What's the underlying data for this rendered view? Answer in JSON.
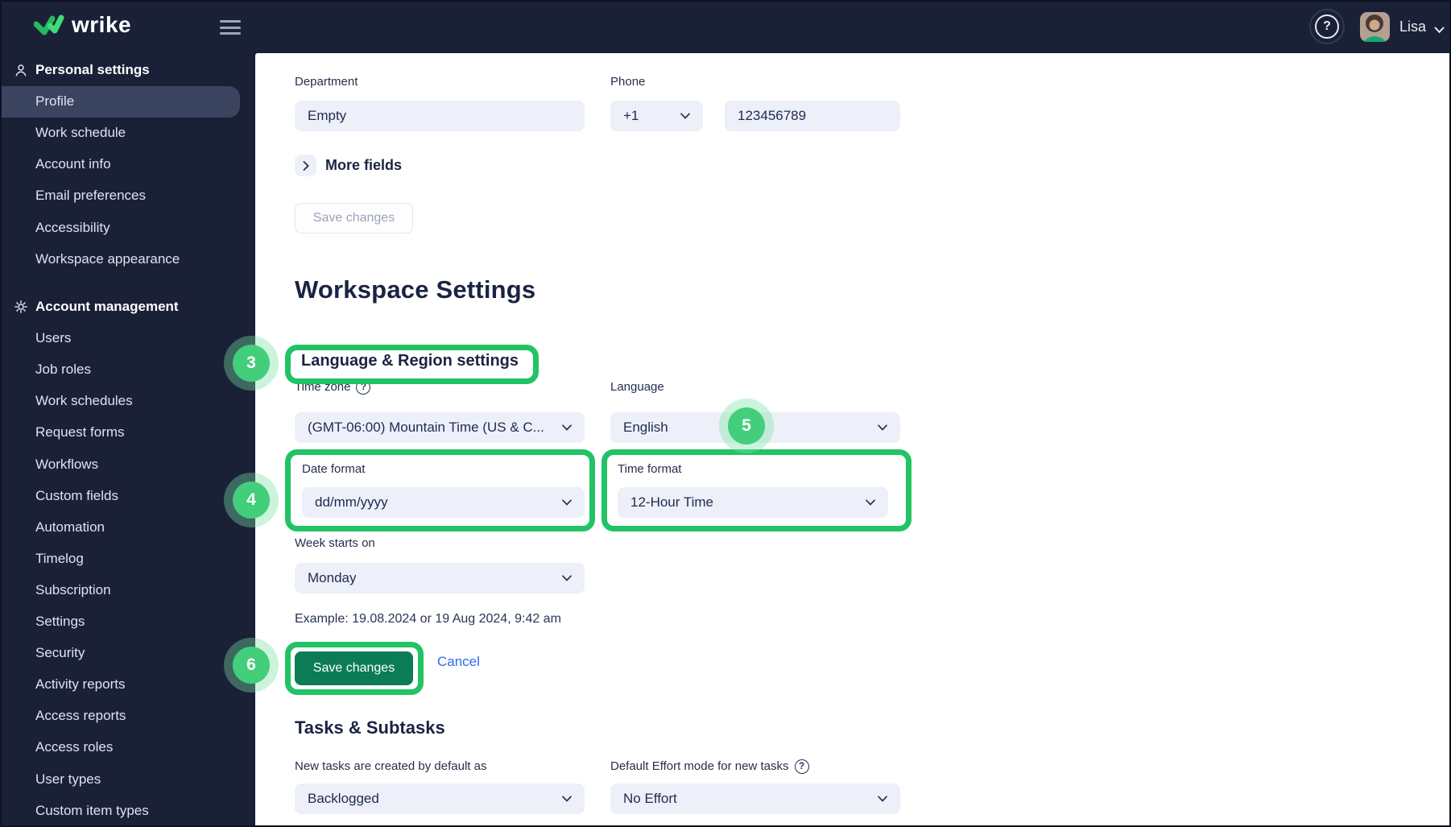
{
  "topbar": {
    "brand": "wrike",
    "user_name": "Lisa"
  },
  "sidebar": {
    "sections": [
      {
        "label": "Personal settings",
        "icon": "person-icon",
        "selected_item": "Profile",
        "items": [
          "Profile",
          "Work schedule",
          "Account info",
          "Email preferences",
          "Accessibility",
          "Workspace appearance"
        ]
      },
      {
        "label": "Account management",
        "icon": "gear-icon",
        "items": [
          "Users",
          "Job roles",
          "Work schedules",
          "Request forms",
          "Workflows",
          "Custom fields",
          "Automation",
          "Timelog",
          "Subscription",
          "Settings",
          "Security",
          "Activity reports",
          "Access reports",
          "Access roles",
          "User types",
          "Custom item types"
        ]
      }
    ]
  },
  "profile_form": {
    "department_label": "Department",
    "department_value": "Empty",
    "phone_label": "Phone",
    "phone_code": "+1",
    "phone_number": "123456789",
    "more_fields_label": "More fields",
    "save_label": "Save changes"
  },
  "workspace_settings": {
    "title": "Workspace Settings",
    "language_region": {
      "heading": "Language & Region settings",
      "time_zone_label": "Time zone",
      "time_zone_value": "(GMT-06:00) Mountain Time (US & C...",
      "language_label": "Language",
      "language_value": "English",
      "date_format_label": "Date format",
      "date_format_value": "dd/mm/yyyy",
      "time_format_label": "Time format",
      "time_format_value": "12-Hour Time",
      "week_starts_label": "Week starts on",
      "week_starts_value": "Monday",
      "example_text": "Example: 19.08.2024 or 19 Aug 2024, 9:42 am",
      "save_label": "Save changes",
      "cancel_label": "Cancel"
    },
    "tasks": {
      "heading": "Tasks & Subtasks",
      "new_tasks_label": "New tasks are created by default as",
      "new_tasks_value": "Backlogged",
      "effort_label": "Default Effort mode for new tasks",
      "effort_value": "No Effort"
    }
  },
  "annotations": {
    "badge_3": "3",
    "badge_4": "4",
    "badge_5": "5",
    "badge_6": "6"
  },
  "colors": {
    "dark_navy": "#1A2137",
    "annotation_green": "#22C365",
    "button_green": "#0C7C57",
    "link_blue": "#3069E4",
    "input_bg": "#EDF0F8"
  }
}
